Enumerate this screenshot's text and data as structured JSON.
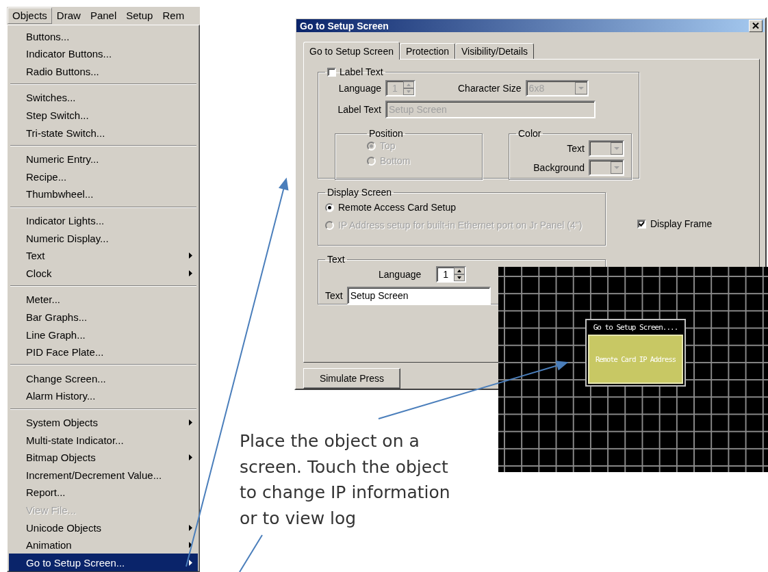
{
  "menubar": [
    {
      "label": "Objects",
      "selected": true
    },
    {
      "label": "Draw",
      "selected": false
    },
    {
      "label": "Panel",
      "selected": false
    },
    {
      "label": "Setup",
      "selected": false
    },
    {
      "label": "Rem",
      "selected": false
    }
  ],
  "menu_groups": [
    [
      {
        "label": "Buttons...",
        "submenu": false,
        "disabled": false,
        "selected": false
      },
      {
        "label": "Indicator Buttons...",
        "submenu": false,
        "disabled": false,
        "selected": false
      },
      {
        "label": "Radio Buttons...",
        "submenu": false,
        "disabled": false,
        "selected": false
      }
    ],
    [
      {
        "label": "Switches...",
        "submenu": false,
        "disabled": false,
        "selected": false
      },
      {
        "label": "Step Switch...",
        "submenu": false,
        "disabled": false,
        "selected": false
      },
      {
        "label": "Tri-state Switch...",
        "submenu": false,
        "disabled": false,
        "selected": false
      }
    ],
    [
      {
        "label": "Numeric Entry...",
        "submenu": false,
        "disabled": false,
        "selected": false
      },
      {
        "label": "Recipe...",
        "submenu": false,
        "disabled": false,
        "selected": false
      },
      {
        "label": "Thumbwheel...",
        "submenu": false,
        "disabled": false,
        "selected": false
      }
    ],
    [
      {
        "label": "Indicator Lights...",
        "submenu": false,
        "disabled": false,
        "selected": false
      },
      {
        "label": "Numeric Display...",
        "submenu": false,
        "disabled": false,
        "selected": false
      },
      {
        "label": "Text",
        "submenu": true,
        "disabled": false,
        "selected": false
      },
      {
        "label": "Clock",
        "submenu": true,
        "disabled": false,
        "selected": false
      }
    ],
    [
      {
        "label": "Meter...",
        "submenu": false,
        "disabled": false,
        "selected": false
      },
      {
        "label": "Bar Graphs...",
        "submenu": false,
        "disabled": false,
        "selected": false
      },
      {
        "label": "Line Graph...",
        "submenu": false,
        "disabled": false,
        "selected": false
      },
      {
        "label": "PID Face Plate...",
        "submenu": false,
        "disabled": false,
        "selected": false
      }
    ],
    [
      {
        "label": "Change Screen...",
        "submenu": false,
        "disabled": false,
        "selected": false
      },
      {
        "label": "Alarm History...",
        "submenu": false,
        "disabled": false,
        "selected": false
      }
    ],
    [
      {
        "label": "System Objects",
        "submenu": true,
        "disabled": false,
        "selected": false
      },
      {
        "label": "Multi-state Indicator...",
        "submenu": false,
        "disabled": false,
        "selected": false
      },
      {
        "label": "Bitmap Objects",
        "submenu": true,
        "disabled": false,
        "selected": false
      },
      {
        "label": "Increment/Decrement Value...",
        "submenu": false,
        "disabled": false,
        "selected": false
      },
      {
        "label": "Report...",
        "submenu": false,
        "disabled": false,
        "selected": false
      },
      {
        "label": "View File...",
        "submenu": false,
        "disabled": true,
        "selected": false
      },
      {
        "label": "Unicode Objects",
        "submenu": true,
        "disabled": false,
        "selected": false
      },
      {
        "label": "Animation",
        "submenu": true,
        "disabled": false,
        "selected": false
      },
      {
        "label": "Go to Setup Screen...",
        "submenu": true,
        "disabled": false,
        "selected": true
      }
    ]
  ],
  "dialog": {
    "title": "Go to Setup Screen",
    "tabs": [
      {
        "label": "Go to Setup Screen",
        "selected": true
      },
      {
        "label": "Protection",
        "selected": false
      },
      {
        "label": "Visibility/Details",
        "selected": false
      }
    ],
    "label_text": {
      "checkbox": {
        "label": "Label Text",
        "checked": false
      },
      "language_label": "Language",
      "language_value": "1",
      "character_size_label": "Character Size",
      "character_size_value": "6x8",
      "label_text_label": "Label Text",
      "label_text_value": "Setup Screen",
      "position": {
        "title": "Position",
        "options": [
          {
            "label": "Top",
            "selected": true
          },
          {
            "label": "Bottom",
            "selected": false
          }
        ]
      },
      "color": {
        "title": "Color",
        "text_label": "Text",
        "background_label": "Background"
      }
    },
    "display_screen": {
      "title": "Display Screen",
      "options": [
        {
          "label": "Remote Access Card Setup",
          "selected": true,
          "disabled": false
        },
        {
          "label": "IP Address setup for built-in Ethernet port on Jr Panel (4\")",
          "selected": false,
          "disabled": true
        }
      ]
    },
    "display_frame": {
      "label": "Display Frame",
      "checked": true
    },
    "text": {
      "title": "Text",
      "language_label": "Language",
      "language_value": "1",
      "text_label": "Text",
      "text_value": "Setup Screen"
    },
    "simulate_button": "Simulate Press"
  },
  "screen_preview": {
    "object_title": "Go to Setup Screen....",
    "object_button": "Remote Card IP Address"
  },
  "callout": "Place the object on a screen. Touch the object to change IP information or to view log"
}
